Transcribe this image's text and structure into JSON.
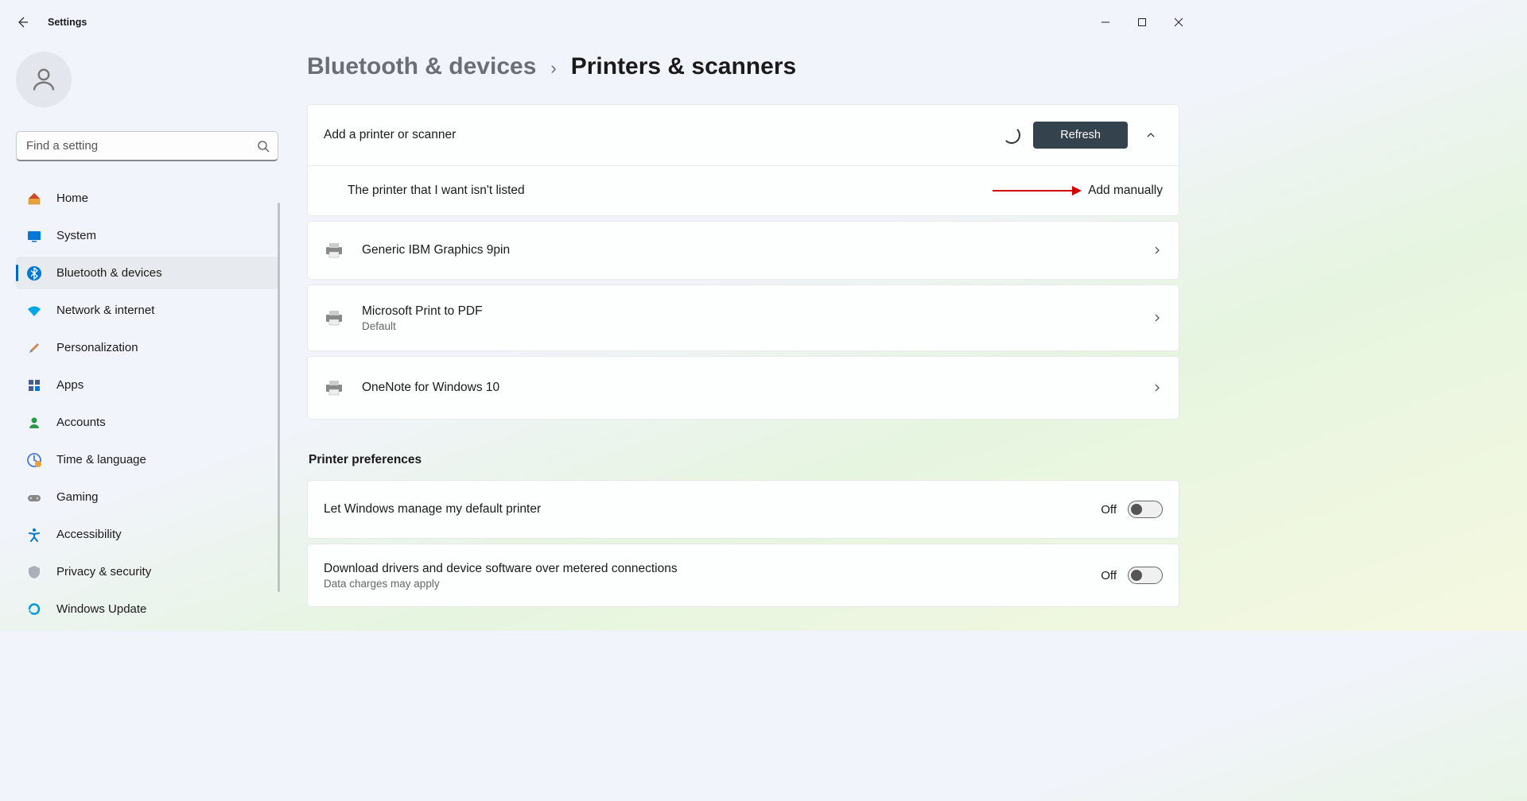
{
  "window": {
    "title": "Settings"
  },
  "search": {
    "placeholder": "Find a setting"
  },
  "nav": {
    "home": "Home",
    "system": "System",
    "bluetooth": "Bluetooth & devices",
    "network": "Network & internet",
    "personalization": "Personalization",
    "apps": "Apps",
    "accounts": "Accounts",
    "time": "Time & language",
    "gaming": "Gaming",
    "accessibility": "Accessibility",
    "privacy": "Privacy & security",
    "update": "Windows Update"
  },
  "breadcrumb": {
    "parent": "Bluetooth & devices",
    "current": "Printers & scanners"
  },
  "add": {
    "title": "Add a printer or scanner",
    "refresh": "Refresh",
    "notlisted": "The printer that I want isn't listed",
    "add_manual": "Add manually"
  },
  "printers": {
    "p1": {
      "name": "Generic IBM Graphics 9pin"
    },
    "p2": {
      "name": "Microsoft Print to PDF",
      "sub": "Default"
    },
    "p3": {
      "name": "OneNote for Windows 10"
    }
  },
  "prefs": {
    "heading": "Printer preferences",
    "default": {
      "title": "Let Windows manage my default printer",
      "state": "Off"
    },
    "metered": {
      "title": "Download drivers and device software over metered connections",
      "sub": "Data charges may apply",
      "state": "Off"
    }
  }
}
